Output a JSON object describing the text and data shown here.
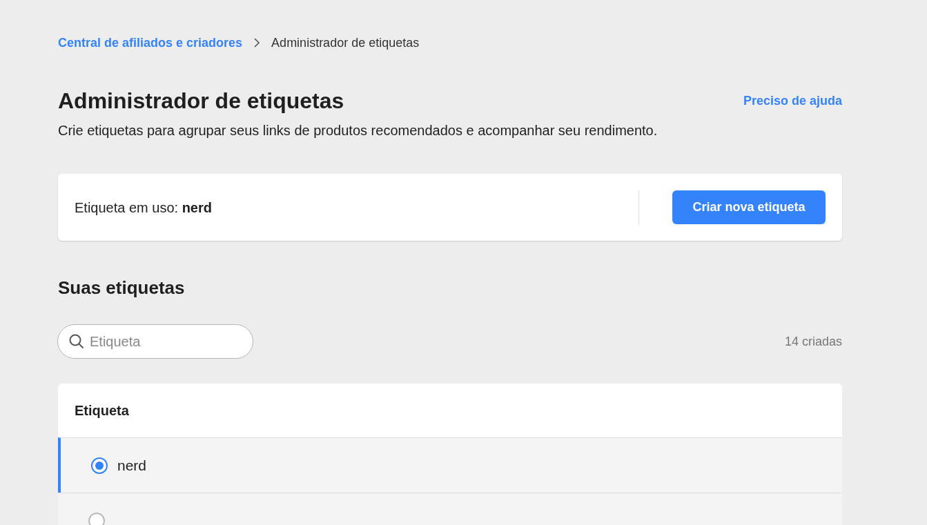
{
  "breadcrumb": [
    {
      "label": "Central de afiliados e criadores",
      "link": true
    },
    {
      "label": "Administrador de etiquetas",
      "link": false
    }
  ],
  "title": "Administrador de etiquetas",
  "help_link": "Preciso de ajuda",
  "description": "Crie etiquetas para agrupar seus links de produtos recomendados e acompanhar seu rendimento.",
  "current_tag": {
    "text": "Etiqueta em uso: **nerd**",
    "button": "Criar nova etiqueta"
  },
  "section_title": "Suas etiquetas",
  "search": {
    "placeholder": "Etiqueta"
  },
  "count": "14 criadas",
  "table": {
    "column": "Etiqueta",
    "rows": [
      {
        "label": "nerd",
        "selected": true
      },
      {
        "selected": false
      }
    ]
  }
}
